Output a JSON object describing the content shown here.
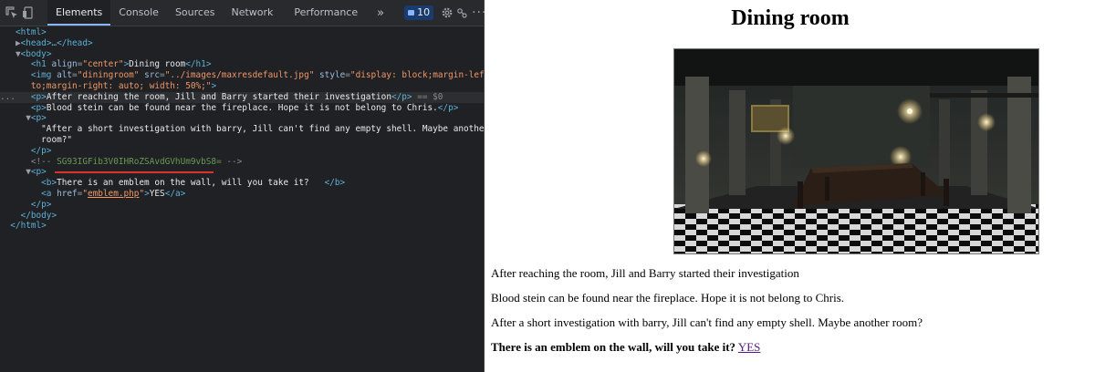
{
  "devtools": {
    "tabs": [
      "Elements",
      "Console",
      "Sources",
      "Network",
      "Performance"
    ],
    "active_tab": "Elements",
    "more_tabs": "»",
    "message_count": "10",
    "kebab": "⋮",
    "close": "✕",
    "dom_lines": {
      "html_open": "<html>",
      "head": "<head>…</head>",
      "body_open": "<body>",
      "h1_open": "<h1 ",
      "h1_attr": "align",
      "h1_val": "\"center\"",
      "h1_text": "Dining room",
      "h1_close": "</h1>",
      "img_open": "<img ",
      "img_alt": "alt",
      "img_alt_val": "\"diningroom\"",
      "img_src": "src",
      "img_src_val": "\"../images/maxresdefault.jpg\"",
      "img_style": "style",
      "img_style_val_1": "\"display: block;margin-left: au",
      "img_style_val_2": "to;margin-right: auto; width: 50%;\"",
      "img_close": ">",
      "p1_text": "After reaching the room, Jill and Barry started their investigation",
      "sel_marker": "== $0",
      "p2_text": "Blood stein can be found near the fireplace. Hope it is not belong to Chris.",
      "p3_text_1": "\"After a short investigation with barry, Jill can't find any empty shell. Maybe another",
      "p3_text_2": "room?\"",
      "comment_open": "<!--",
      "comment_text": "SG93IGFib3V0IHRoZSAvdGVhUm9vbS8=",
      "comment_close": "-->",
      "b_text": "There is an emblem on the wall, will you take it?",
      "a_attr": "href",
      "a_href": "emblem.php",
      "a_text": "YES",
      "body_close": "</body>",
      "html_close": "</html>"
    }
  },
  "page": {
    "title": "Dining room",
    "image_alt": "diningroom",
    "paragraphs": [
      "After reaching the room, Jill and Barry started their investigation",
      "Blood stein can be found near the fireplace. Hope it is not belong to Chris.",
      "After a short investigation with barry, Jill can't find any empty shell. Maybe another room?"
    ],
    "emblem_question": "There is an emblem on the wall, will you take it?",
    "emblem_link": "YES"
  }
}
